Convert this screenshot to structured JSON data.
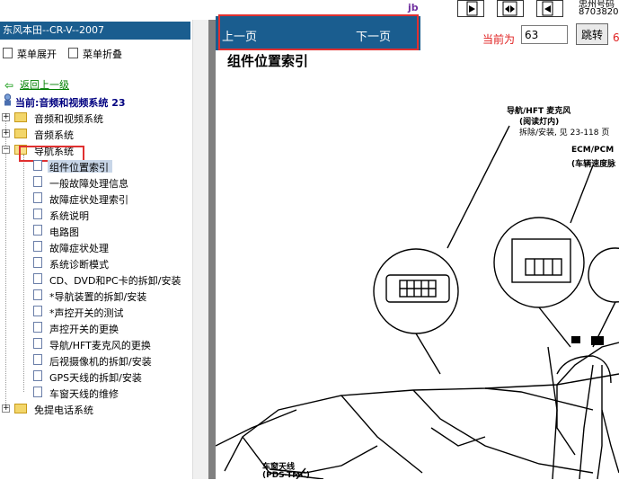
{
  "top_strip": {
    "logo_text": "jb",
    "right_text_1": "忠州号码",
    "right_text_2": "8703820"
  },
  "left": {
    "title": "东风本田--CR-V--2007",
    "expand_label": "菜单展开",
    "collapse_label": "菜单折叠",
    "back_label": "返回上一级",
    "current_label": "当前:音频和视频系统 23",
    "tree": [
      {
        "label": "音频和视频系统",
        "state": "+"
      },
      {
        "label": "音频系统",
        "state": "+"
      },
      {
        "label": "导航系统",
        "state": "-"
      }
    ],
    "nav_children": [
      "组件位置索引",
      "一般故障处理信息",
      "故障症状处理索引",
      "系统说明",
      "电路图",
      "故障症状处理",
      "系统诊断模式",
      "CD、DVD和PC卡的拆卸/安装",
      "*导航装置的拆卸/安装",
      "*声控开关的测试",
      "声控开关的更换",
      "导航/HFT麦克风的更换",
      "后视摄像机的拆卸/安装",
      "GPS天线的拆卸/安装",
      "车窗天线的维修"
    ],
    "last_tree": {
      "label": "免提电话系统",
      "state": "+"
    }
  },
  "toolbar": {
    "prev_label": "上一页",
    "next_label": "下一页",
    "current_page_label": "当前为",
    "page_value": "63",
    "jump_label": "跳转",
    "right_text": "6"
  },
  "document": {
    "title": "组件位置索引",
    "callouts": {
      "mic_title": "导航/HFT 麦克风",
      "mic_sub": "(阅读灯内)",
      "mic_ref": "拆除/安装, 见 23-118 页",
      "ecm_title": "ECM/PCM",
      "ecm_sub": "(车辆速度脉",
      "antenna_title": "车窗天线",
      "antenna_sub": "(PDS-TMC)"
    }
  },
  "colors": {
    "title_bar": "#1a5d8f",
    "highlight_box": "#e03030",
    "link_green": "#008000",
    "current_blue": "#000080"
  }
}
